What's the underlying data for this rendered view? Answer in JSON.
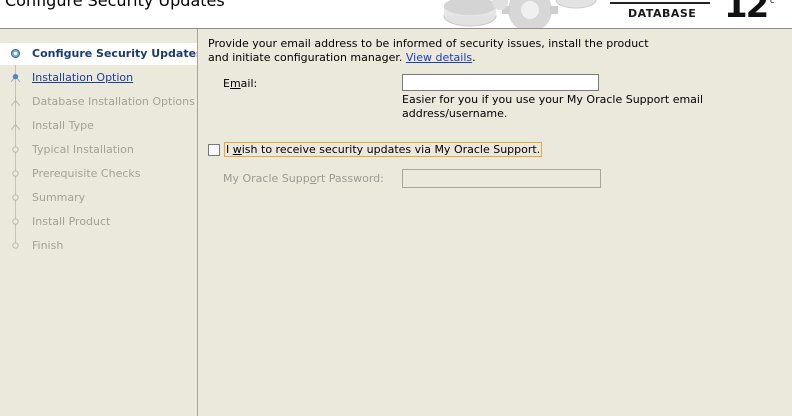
{
  "header": {
    "title": "Configure Security Updates",
    "brand_product": "DATABASE",
    "brand_version": "12",
    "brand_suffix": "c"
  },
  "steps": [
    {
      "label": "Configure Security Updates",
      "state": "current"
    },
    {
      "label": "Installation Option",
      "state": "link"
    },
    {
      "label": "Database Installation Options",
      "state": "disabled"
    },
    {
      "label": "Install Type",
      "state": "disabled"
    },
    {
      "label": "Typical Installation",
      "state": "disabled"
    },
    {
      "label": "Prerequisite Checks",
      "state": "disabled"
    },
    {
      "label": "Summary",
      "state": "disabled"
    },
    {
      "label": "Install Product",
      "state": "disabled"
    },
    {
      "label": "Finish",
      "state": "disabled"
    }
  ],
  "main": {
    "intro_line1": "Provide your email address to be informed of security issues, install the product",
    "intro_line2": "and initiate configuration manager.",
    "view_details": "View details",
    "intro_end": ".",
    "email_label_pre": "E",
    "email_label_mn": "m",
    "email_label_post": "ail:",
    "email_value": "",
    "email_hint_line1": "Easier for you if you use your My Oracle Support email",
    "email_hint_line2": "address/username.",
    "checkbox_pre": "I ",
    "checkbox_mn": "w",
    "checkbox_post": "ish to receive security updates via My Oracle Support.",
    "checkbox_checked": false,
    "password_label_pre": "My Oracle Supp",
    "password_label_mn": "o",
    "password_label_post": "rt Password:",
    "password_value": ""
  }
}
